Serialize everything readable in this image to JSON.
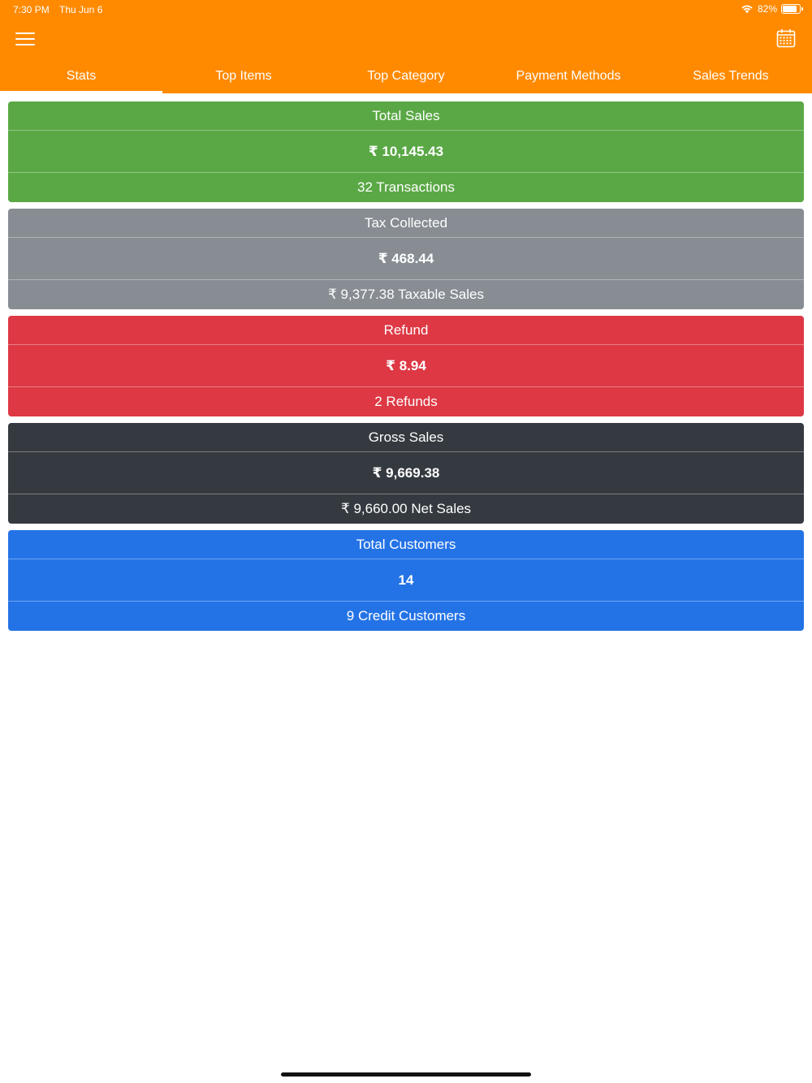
{
  "status_bar": {
    "time": "7:30 PM",
    "date": "Thu Jun 6",
    "battery": "82%"
  },
  "header": {
    "background_color": "#ff8a00",
    "menu_icon": "hamburger-menu-icon",
    "calendar_icon": "calendar-icon"
  },
  "tabs": [
    {
      "label": "Stats",
      "active": true
    },
    {
      "label": "Top Items",
      "active": false
    },
    {
      "label": "Top Category",
      "active": false
    },
    {
      "label": "Payment Methods",
      "active": false
    },
    {
      "label": "Sales Trends",
      "active": false
    }
  ],
  "cards": [
    {
      "title": "Total Sales",
      "value": "₹ 10,145.43",
      "sub": "32 Transactions",
      "color": "#5aa845"
    },
    {
      "title": "Tax Collected",
      "value": "₹ 468.44",
      "sub": "₹ 9,377.38 Taxable Sales",
      "color": "#878d93"
    },
    {
      "title": "Refund",
      "value": "₹ 8.94",
      "sub": "2 Refunds",
      "color": "#dd3844"
    },
    {
      "title": "Gross Sales",
      "value": "₹ 9,669.38",
      "sub": "₹ 9,660.00 Net Sales",
      "color": "#353a40"
    },
    {
      "title": "Total Customers",
      "value": "14",
      "sub": "9 Credit Customers",
      "color": "#2473e6"
    }
  ]
}
